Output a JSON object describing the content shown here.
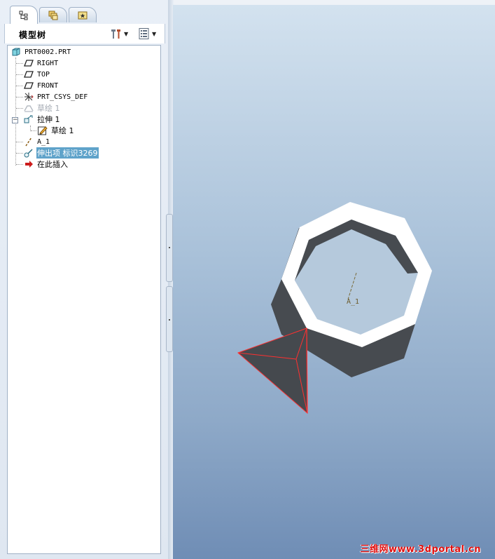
{
  "panel": {
    "tabs": [
      {
        "name": "model-tree-tab",
        "icon": "model-tree-icon",
        "active": true
      },
      {
        "name": "layers-tab",
        "icon": "layers-icon",
        "active": false
      },
      {
        "name": "favorites-tab",
        "icon": "favorites-icon",
        "active": false
      }
    ],
    "title": "模型树",
    "settings_icon": "tree-settings-icon",
    "show_icon": "tree-show-icon"
  },
  "tree": {
    "items": [
      {
        "label": "PRT0002.PRT",
        "icon": "part-icon"
      },
      {
        "label": "RIGHT",
        "icon": "datum-plane-icon"
      },
      {
        "label": "TOP",
        "icon": "datum-plane-icon"
      },
      {
        "label": "FRONT",
        "icon": "datum-plane-icon"
      },
      {
        "label": "PRT_CSYS_DEF",
        "icon": "coordinate-system-icon"
      },
      {
        "label": "草绘 1",
        "icon": "sketch-icon",
        "state": "suppressed"
      },
      {
        "label": "拉伸 1",
        "icon": "extrude-icon",
        "expanded": true
      },
      {
        "label": "草绘 1",
        "icon": "sketch-icon"
      },
      {
        "label": "A_1",
        "icon": "datum-axis-icon"
      },
      {
        "label": "伸出项 标识3269",
        "icon": "protrusion-icon",
        "state": "selected"
      },
      {
        "label": "在此插入",
        "icon": "insert-here-arrow-icon"
      }
    ]
  },
  "graphics": {
    "axis_label": "A_1",
    "background_top": "#d3e2ef",
    "background_bottom": "#6f8db5",
    "model_color": "#474b50",
    "edge_highlight": "#ff3030"
  },
  "watermark": "三维网www.3dportal.cn"
}
